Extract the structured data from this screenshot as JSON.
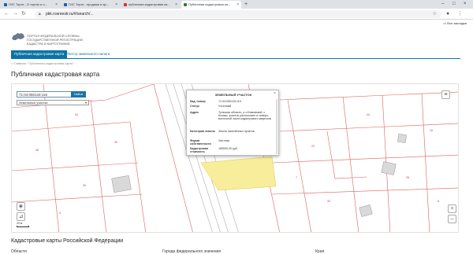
{
  "browser": {
    "tabs": [
      {
        "label": "ГИС Торги - О торгах и о...",
        "fav": "#1a5fb4"
      },
      {
        "label": "ГИС Торги - продажа и ар...",
        "fav": "#1a5fb4"
      },
      {
        "label": "публичная кадастровая ка...",
        "fav": "#d32f2f"
      },
      {
        "label": "Публичная кадастровая ка...",
        "fav": "#2e7d32"
      }
    ],
    "url": "pkk.rosreestr.ru/#/search/...",
    "bookmarks_label": "Все закладки"
  },
  "site": {
    "logo_text_line1": "ПОРТАЛ ФЕДЕРАЛЬНОЙ СЛУЖБЫ",
    "logo_text_line2": "ГОСУДАРСТВЕННОЙ РЕГИСТРАЦИИ,",
    "logo_text_line3": "КАДАСТРА И КАРТОГРАФИИ",
    "nav_tab_active": "Публичная кадастровая карта",
    "nav_tab_other": "Реестр земельного налога",
    "breadcrumb_home": "Главная",
    "breadcrumb_sep": "›",
    "breadcrumb_current": "Публичная кадастровая карта",
    "page_title": "Публичная кадастровая карта"
  },
  "map": {
    "search_value": "71:04:050133:115",
    "search_button": "Найти",
    "select_value": "Земельные участки",
    "scale_label": "20 м",
    "parcel_numbers": [
      "34",
      "45",
      "30",
      "26",
      "22",
      "44",
      "33",
      "25",
      "19",
      "7",
      "8",
      "4"
    ]
  },
  "popup": {
    "title": "ЗЕМЕЛЬНЫЙ УЧАСТОК",
    "rows": [
      {
        "k": "Кад. номер",
        "v": "71:04:050133:115"
      },
      {
        "k": "Статус",
        "v": "Учтенный"
      },
      {
        "k": "Адрес",
        "v": "Тульская область, р-н Кимовский, с. Кочаки, участок расположен в северо-восточной части кадастрового квартала"
      },
      {
        "k": "Категория земель",
        "v": "Земли населённых пунктов"
      },
      {
        "k": "Форма собственности",
        "v": "Частная"
      },
      {
        "k": "Кадастровая стоимость",
        "v": "185000.00 руб."
      }
    ]
  },
  "bottom": {
    "section_title": "Кадастровые карты Российской Федерации",
    "col1": "Области",
    "col2": "Города федерального значения",
    "col3": "Края"
  }
}
